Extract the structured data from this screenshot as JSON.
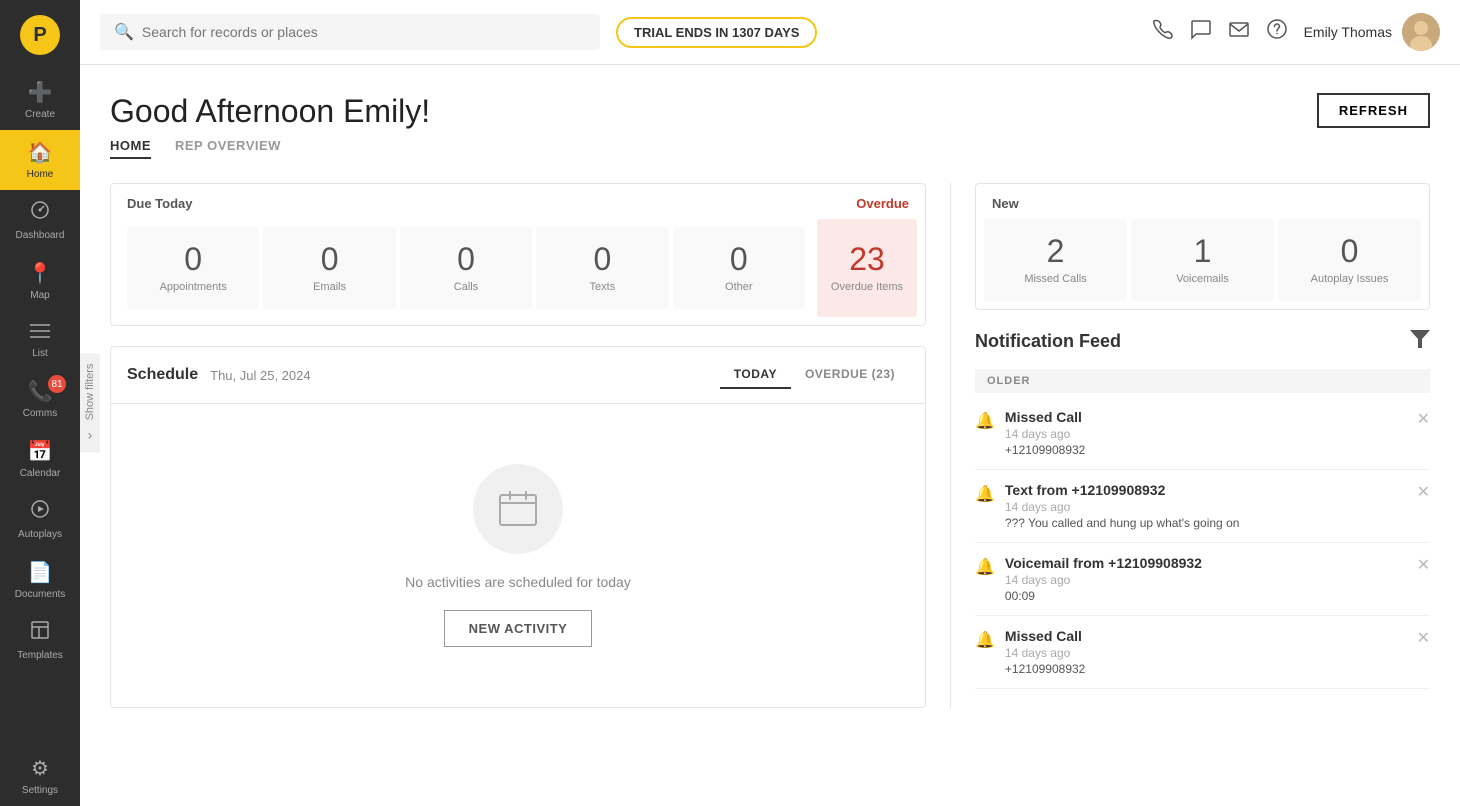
{
  "app": {
    "logo_text": "P"
  },
  "topnav": {
    "search_placeholder": "Search for records or places",
    "trial_badge": "TRIAL ENDS IN 1307 DAYS",
    "user_name": "Emily Thomas"
  },
  "sidebar": {
    "items": [
      {
        "id": "create",
        "label": "Create",
        "icon": "➕",
        "active": false
      },
      {
        "id": "home",
        "label": "Home",
        "icon": "🏠",
        "active": true
      },
      {
        "id": "dashboard",
        "label": "Dashboard",
        "icon": "⊞",
        "active": false
      },
      {
        "id": "map",
        "label": "Map",
        "icon": "📍",
        "active": false
      },
      {
        "id": "list",
        "label": "List",
        "icon": "≡",
        "active": false
      },
      {
        "id": "comms",
        "label": "Comms",
        "icon": "📞",
        "active": false,
        "badge": "81"
      },
      {
        "id": "calendar",
        "label": "Calendar",
        "icon": "📅",
        "active": false
      },
      {
        "id": "autoplays",
        "label": "Autoplays",
        "icon": "▶",
        "active": false
      },
      {
        "id": "documents",
        "label": "Documents",
        "icon": "📄",
        "active": false
      },
      {
        "id": "templates",
        "label": "Templates",
        "icon": "⬜",
        "active": false
      },
      {
        "id": "settings",
        "label": "Settings",
        "icon": "⚙",
        "active": false
      }
    ]
  },
  "page": {
    "greeting": "Good Afternoon Emily!",
    "tabs": [
      {
        "id": "home",
        "label": "HOME",
        "active": true
      },
      {
        "id": "rep-overview",
        "label": "REP OVERVIEW",
        "active": false
      }
    ],
    "refresh_label": "REFRESH"
  },
  "due_today": {
    "title": "Due Today",
    "stats": [
      {
        "id": "appointments",
        "number": "0",
        "label": "Appointments"
      },
      {
        "id": "emails",
        "number": "0",
        "label": "Emails"
      },
      {
        "id": "calls",
        "number": "0",
        "label": "Calls"
      },
      {
        "id": "texts",
        "number": "0",
        "label": "Texts"
      },
      {
        "id": "other",
        "number": "0",
        "label": "Other"
      }
    ],
    "overdue": {
      "number": "23",
      "label": "Overdue Items"
    }
  },
  "new_section": {
    "title": "New",
    "stats": [
      {
        "id": "missed-calls",
        "number": "2",
        "label": "Missed Calls"
      },
      {
        "id": "voicemails",
        "number": "1",
        "label": "Voicemails"
      },
      {
        "id": "autoplay-issues",
        "number": "0",
        "label": "Autoplay Issues"
      }
    ]
  },
  "schedule": {
    "title": "Schedule",
    "date": "Thu, Jul 25, 2024",
    "tabs": [
      {
        "id": "today",
        "label": "TODAY",
        "active": true
      },
      {
        "id": "overdue",
        "label": "OVERDUE (23)",
        "active": false
      }
    ],
    "empty_message": "No activities are scheduled for today",
    "new_activity_label": "NEW ACTIVITY"
  },
  "notification_feed": {
    "title": "Notification Feed",
    "section_label": "OLDER",
    "notifications": [
      {
        "id": "notif-1",
        "type": "Missed Call",
        "time": "14 days ago",
        "detail": "+12109908932"
      },
      {
        "id": "notif-2",
        "type": "Text from +12109908932",
        "time": "14 days ago",
        "detail": "??? You called and hung up what's going on"
      },
      {
        "id": "notif-3",
        "type": "Voicemail from +12109908932",
        "time": "14 days ago",
        "detail": "00:09"
      },
      {
        "id": "notif-4",
        "type": "Missed Call",
        "time": "14 days ago",
        "detail": "+12109908932"
      }
    ]
  },
  "show_filters_label": "Show filters"
}
